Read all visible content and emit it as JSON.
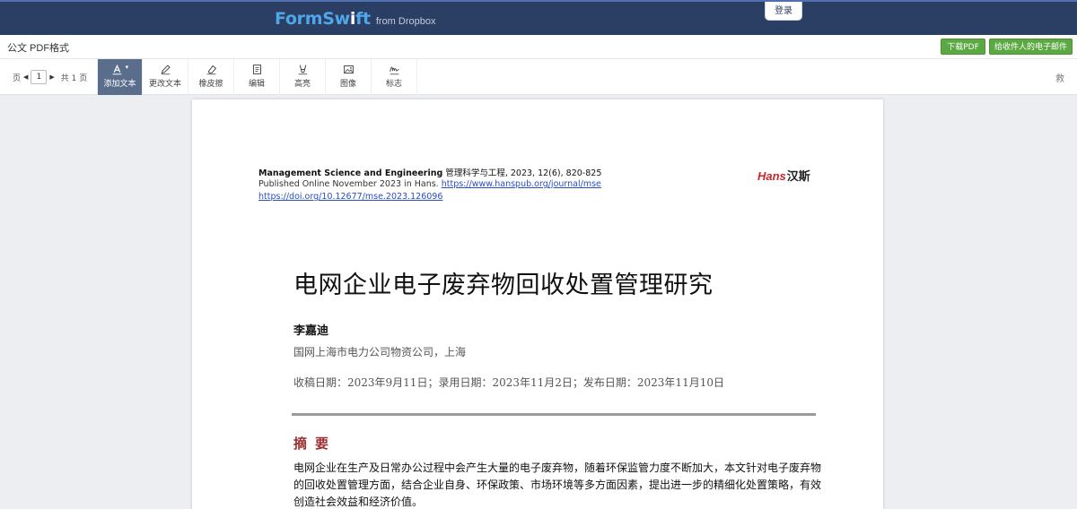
{
  "app": {
    "brand": "FormSwift",
    "brand_from": "from Dropbox",
    "login_label": "登录"
  },
  "titlebar": {
    "document_title": "公文 PDF格式",
    "download_label": "下载PDF",
    "email_label": "给收件人的电子邮件"
  },
  "toolbar": {
    "page_label": "页",
    "current_page": "1",
    "total_label": "共 1 页",
    "tools": [
      {
        "label": "添加文本",
        "icon": "text-add-icon"
      },
      {
        "label": "更改文本",
        "icon": "pen-edit-icon"
      },
      {
        "label": "橡皮擦",
        "icon": "eraser-icon"
      },
      {
        "label": "编辑",
        "icon": "document-edit-icon"
      },
      {
        "label": "高亮",
        "icon": "highlighter-icon"
      },
      {
        "label": "图像",
        "icon": "image-icon"
      },
      {
        "label": "标志",
        "icon": "signature-icon"
      }
    ],
    "right_glyph": "救"
  },
  "document": {
    "journal_line_bold": "Management Science and Engineering",
    "journal_line_rest": " 管理科学与工程, 2023, 12(6), 820-825",
    "published_text": "Published Online November 2023 in Hans. ",
    "published_url": "https://www.hanspub.org/journal/mse",
    "doi_url": "https://doi.org/10.12677/mse.2023.126096",
    "logo_en": "Hans",
    "logo_cn": "汉斯",
    "title": "电网企业电子废弃物回收处置管理研究",
    "author": "李嘉迪",
    "affiliation": "国网上海市电力公司物资公司，上海",
    "dates": "收稿日期：2023年9月11日；录用日期：2023年11月2日；发布日期：2023年11月10日",
    "abstract_heading": "摘要",
    "abstract_text": "电网企业在生产及日常办公过程中会产生大量的电子废弃物，随着环保监管力度不断加大，本文针对电子废弃物的回收处置管理方面，结合企业自身、环保政策、市场环境等多方面因素，提出进一步的精细化处置策略，有效创造社会效益和经济价值。"
  },
  "colors": {
    "topbar_bg": "#2b3e63",
    "brand_blue": "#4fa6e8",
    "button_green": "#5ca944",
    "active_tool": "#5a6e8c",
    "abstract_heading": "#9b2f2f",
    "link": "#2a4dc4"
  }
}
